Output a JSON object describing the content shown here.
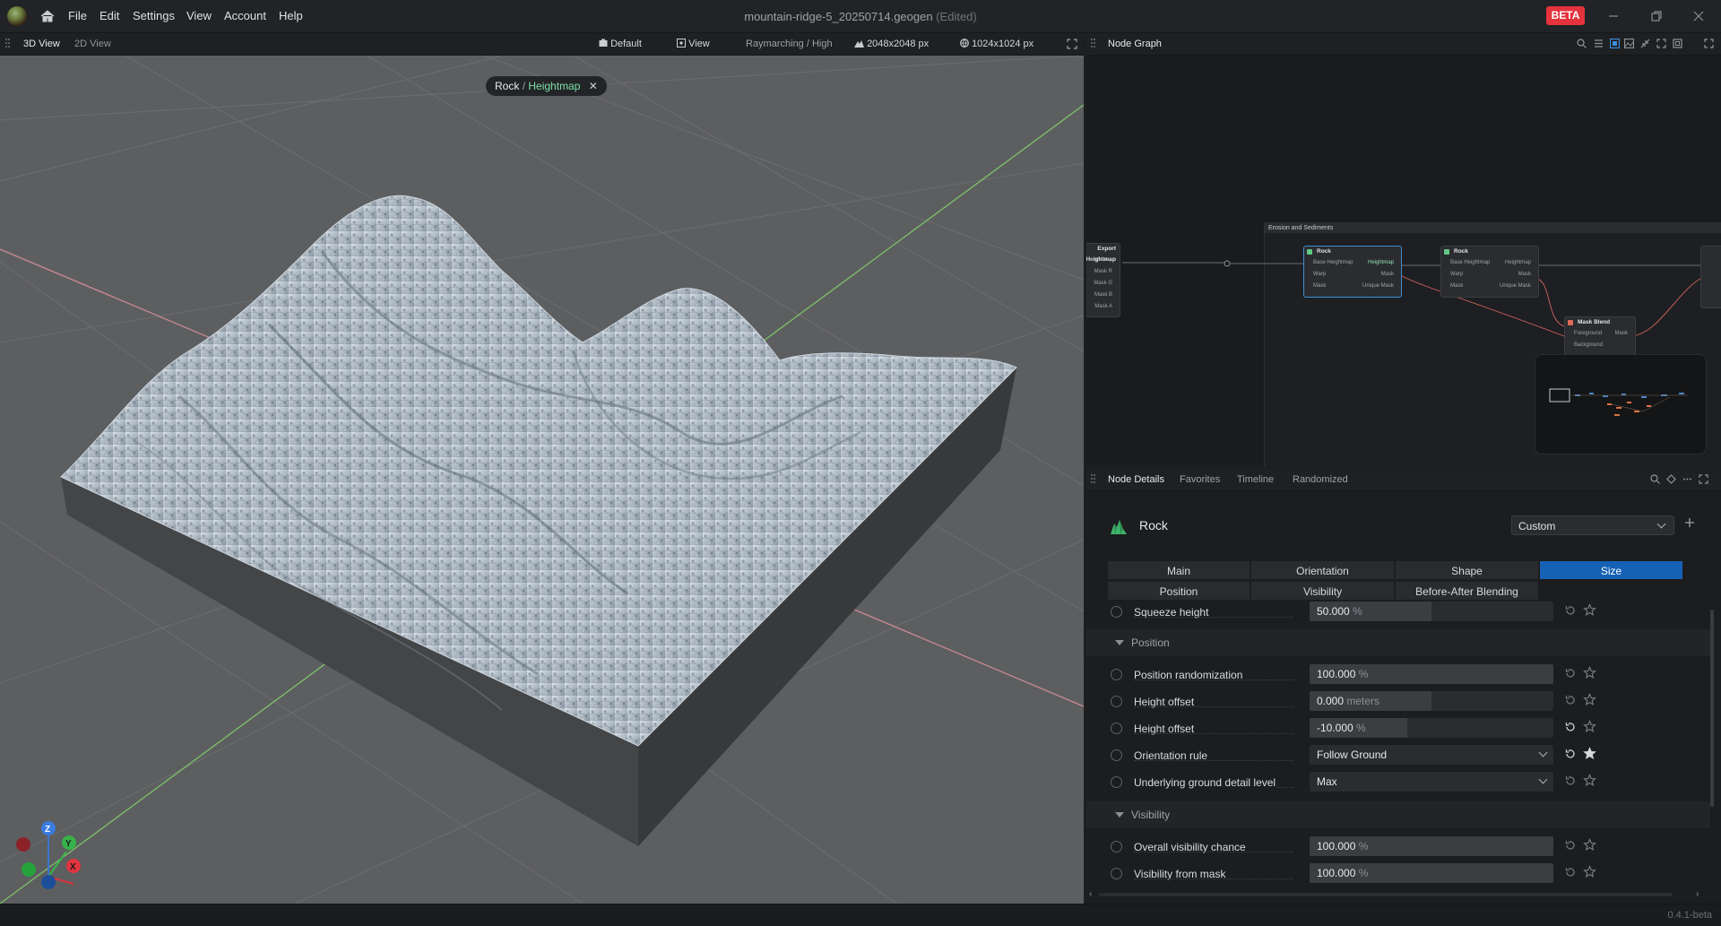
{
  "app": {
    "document_title": "mountain-ridge-5_20250714.geogen",
    "edited_suffix": "(Edited)",
    "beta_badge": "BETA",
    "menu": [
      "File",
      "Edit",
      "Settings",
      "View",
      "Account",
      "Help"
    ],
    "version": "0.4.1-beta"
  },
  "viewport": {
    "tabs": [
      "3D View",
      "2D View"
    ],
    "active_tab": "3D View",
    "camera_preset": "Default",
    "view_menu": "View",
    "render_mode": "Raymarching / High",
    "terrain_resolution": "2048x2048 px",
    "texture_resolution": "1024x1024 px",
    "breadcrumb": {
      "node": "Rock",
      "separator": "/",
      "output": "Heightmap"
    },
    "gizmo_axes": [
      "Z",
      "Y",
      "X"
    ]
  },
  "node_graph": {
    "title": "Node Graph",
    "group_label": "Erosion and Sediments",
    "nodes": {
      "export": {
        "title": "Export Heightmap",
        "ports": [
          "Heightmap",
          "Mask R",
          "Mask G",
          "Mask B",
          "Mask A"
        ]
      },
      "rock1": {
        "title": "Rock",
        "inputs": [
          "Base Heightmap",
          "Warp",
          "Mask"
        ],
        "outputs": [
          "Heightmap",
          "Mask",
          "Unique Mask"
        ]
      },
      "rock2": {
        "title": "Rock",
        "inputs": [
          "Base Heightmap",
          "Warp",
          "Mask"
        ],
        "outputs": [
          "Heightmap",
          "Mask",
          "Unique Mask"
        ]
      },
      "maskblend": {
        "title": "Mask Blend",
        "inputs": [
          "Foreground",
          "Background"
        ],
        "outputs": [
          "Mask"
        ]
      }
    }
  },
  "node_details": {
    "tabs": [
      "Node Details",
      "Favorites",
      "Timeline",
      "Randomized"
    ],
    "node_name": "Rock",
    "preset": "Custom",
    "param_tabs_row1": [
      "Main",
      "Orientation",
      "Shape",
      "Size"
    ],
    "param_tabs_row2": [
      "Position",
      "Visibility",
      "Before-After Blending"
    ],
    "active_param_tab": "Size",
    "params": {
      "squeeze_height": {
        "label": "Squeeze height",
        "value": "50.000",
        "unit": "%",
        "fill": 0.5
      },
      "position_section": "Position",
      "position_randomization": {
        "label": "Position randomization",
        "value": "100.000",
        "unit": "%",
        "fill": 1.0
      },
      "height_offset_m": {
        "label": "Height offset",
        "value": "0.000",
        "unit": "meters",
        "fill": 0.5
      },
      "height_offset_pct": {
        "label": "Height offset",
        "value": "-10.000",
        "unit": "%",
        "fill": 0.4
      },
      "orientation_rule": {
        "label": "Orientation rule",
        "value": "Follow Ground"
      },
      "ground_detail": {
        "label": "Underlying ground detail level",
        "value": "Max"
      },
      "visibility_section": "Visibility",
      "overall_visibility": {
        "label": "Overall visibility chance",
        "value": "100.000",
        "unit": "%",
        "fill": 1.0
      },
      "visibility_from_mask": {
        "label": "Visibility from mask",
        "value": "100.000",
        "unit": "%",
        "fill": 1.0
      }
    }
  },
  "colors": {
    "accent": "#1561b5",
    "beta": "#e5333d",
    "highlight": "#7ee0a6",
    "viewport_bg": "#5d5e60"
  }
}
